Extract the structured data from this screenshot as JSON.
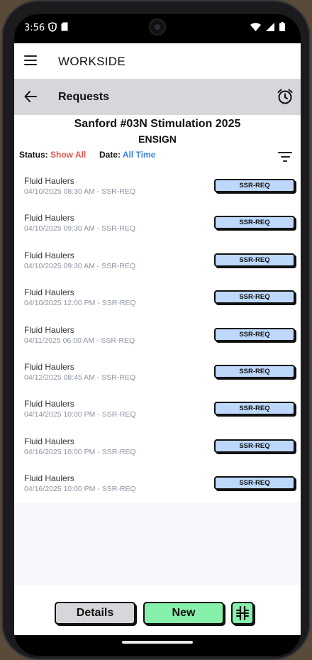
{
  "status_bar": {
    "time": "3:56"
  },
  "app_bar": {
    "title": "WORKSIDE"
  },
  "sub_bar": {
    "title": "Requests"
  },
  "project": {
    "title": "Sanford #03N Stimulation 2025",
    "company": "ENSIGN"
  },
  "filters": {
    "status_label": "Status:",
    "status_value": "Show All",
    "date_label": "Date:",
    "date_value": "All Time"
  },
  "requests": [
    {
      "title": "Fluid Haulers",
      "subtitle": "04/10/2025 08:30 AM - SSR-REQ",
      "badge": "SSR-REQ"
    },
    {
      "title": "Fluid Haulers",
      "subtitle": "04/10/2025 09:30 AM - SSR-REQ",
      "badge": "SSR-REQ"
    },
    {
      "title": "Fluid Haulers",
      "subtitle": "04/10/2025 09:30 AM - SSR-REQ",
      "badge": "SSR-REQ"
    },
    {
      "title": "Fluid Haulers",
      "subtitle": "04/10/2025 12:00 PM - SSR-REQ",
      "badge": "SSR-REQ"
    },
    {
      "title": "Fluid Haulers",
      "subtitle": "04/11/2025 06:00 AM - SSR-REQ",
      "badge": "SSR-REQ"
    },
    {
      "title": "Fluid Haulers",
      "subtitle": "04/12/2025 08:45 AM - SSR-REQ",
      "badge": "SSR-REQ"
    },
    {
      "title": "Fluid Haulers",
      "subtitle": "04/14/2025 10:00 PM - SSR-REQ",
      "badge": "SSR-REQ"
    },
    {
      "title": "Fluid Haulers",
      "subtitle": "04/16/2025 10:00 PM - SSR-REQ",
      "badge": "SSR-REQ"
    },
    {
      "title": "Fluid Haulers",
      "subtitle": "04/16/2025 10:00 PM - SSR-REQ",
      "badge": "SSR-REQ"
    }
  ],
  "footer": {
    "details_label": "Details",
    "new_label": "New"
  },
  "colors": {
    "status_value": "#e0554d",
    "date_value": "#3b82e6",
    "badge_bg": "#bdd8fb",
    "new_button_bg": "#86f0aa",
    "details_button_bg": "#d5d7db",
    "sub_bar_bg": "#d5d7db"
  },
  "icons": {
    "menu": "hamburger-icon",
    "back": "arrow-left-icon",
    "alarm": "alarm-clock-icon",
    "filter": "filter-lines-icon",
    "footer_action": "columns-split-icon"
  }
}
